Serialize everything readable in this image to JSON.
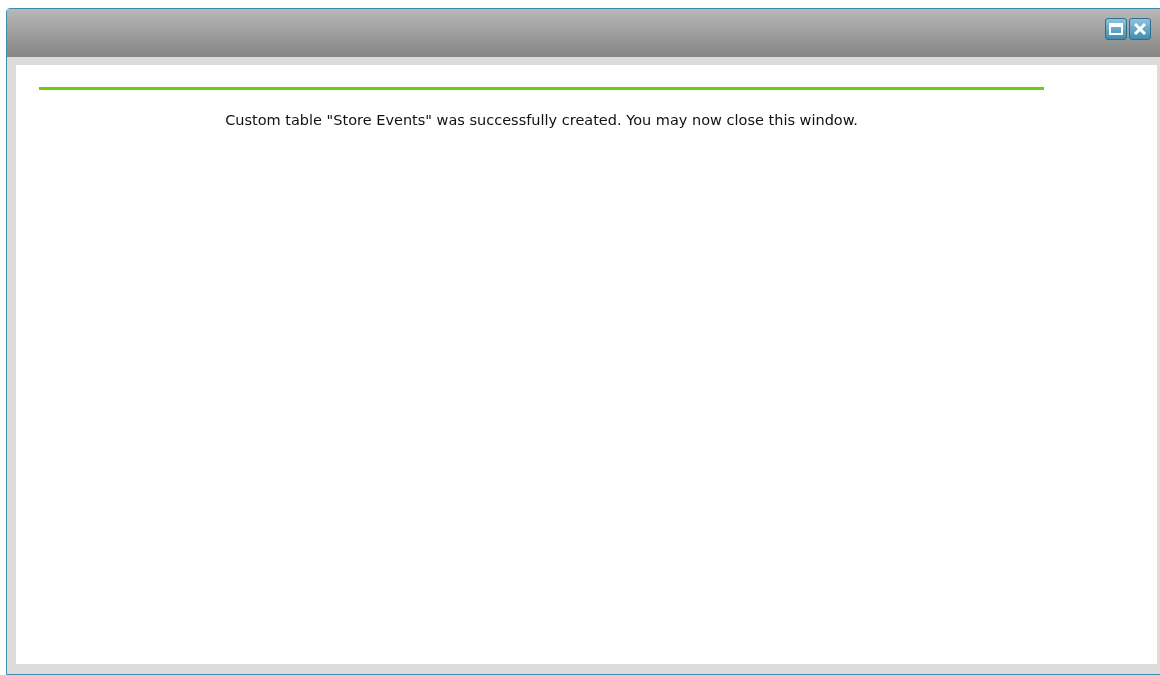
{
  "dialog": {
    "message": "Custom table \"Store Events\" was successfully created. You may now close this window."
  }
}
